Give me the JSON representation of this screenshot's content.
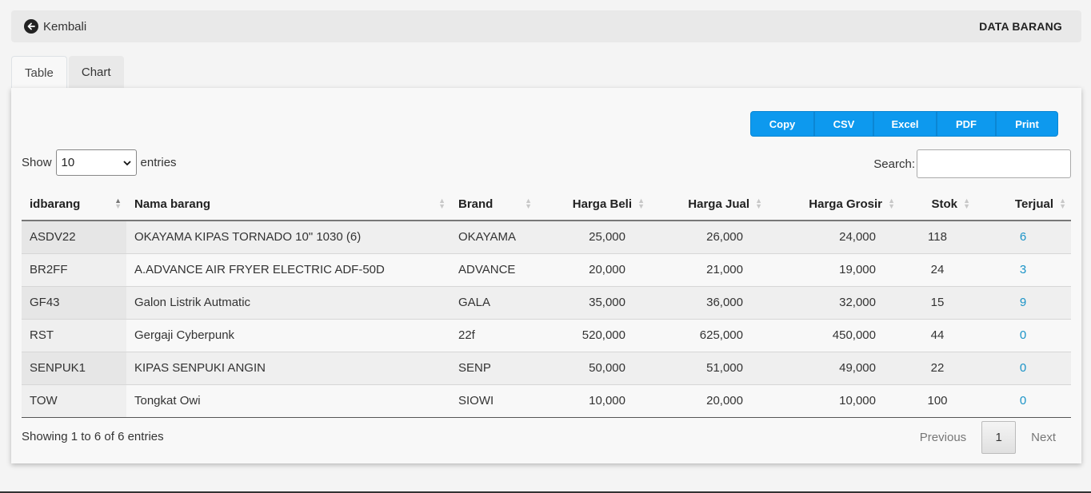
{
  "header": {
    "back_label": "Kembali",
    "title": "DATA BARANG"
  },
  "tabs": [
    {
      "label": "Table",
      "active": true
    },
    {
      "label": "Chart",
      "active": false
    }
  ],
  "export_buttons": [
    "Copy",
    "CSV",
    "Excel",
    "PDF",
    "Print"
  ],
  "length_control": {
    "prefix": "Show",
    "selected": "10",
    "suffix": "entries"
  },
  "search": {
    "label": "Search:",
    "value": ""
  },
  "table": {
    "columns": [
      "idbarang",
      "Nama barang",
      "Brand",
      "Harga Beli",
      "Harga Jual",
      "Harga Grosir",
      "Stok",
      "Terjual"
    ],
    "sorted_column": "idbarang",
    "sort_direction": "ascending",
    "rows": [
      [
        "ASDV22",
        "OKAYAMA KIPAS TORNADO 10\" 1030 (6)",
        "OKAYAMA",
        "25,000",
        "26,000",
        "24,000",
        "118",
        "6"
      ],
      [
        "BR2FF",
        "A.ADVANCE AIR FRYER ELECTRIC ADF-50D",
        "ADVANCE",
        "20,000",
        "21,000",
        "19,000",
        "24",
        "3"
      ],
      [
        "GF43",
        "Galon Listrik Autmatic",
        "GALA",
        "35,000",
        "36,000",
        "32,000",
        "15",
        "9"
      ],
      [
        "RST",
        "Gergaji Cyberpunk",
        "22f",
        "520,000",
        "625,000",
        "450,000",
        "44",
        "0"
      ],
      [
        "SENPUK1",
        "KIPAS SENPUKI ANGIN",
        "SENP",
        "50,000",
        "51,000",
        "49,000",
        "22",
        "0"
      ],
      [
        "TOW",
        "Tongkat Owi",
        "SIOWI",
        "10,000",
        "20,000",
        "10,000",
        "100",
        "0"
      ]
    ]
  },
  "footer": {
    "info": "Showing 1 to 6 of 6 entries",
    "previous": "Previous",
    "current_page": "1",
    "next": "Next"
  },
  "colors": {
    "button_blue": "#0d99ee",
    "link_blue": "#1a93c7"
  }
}
